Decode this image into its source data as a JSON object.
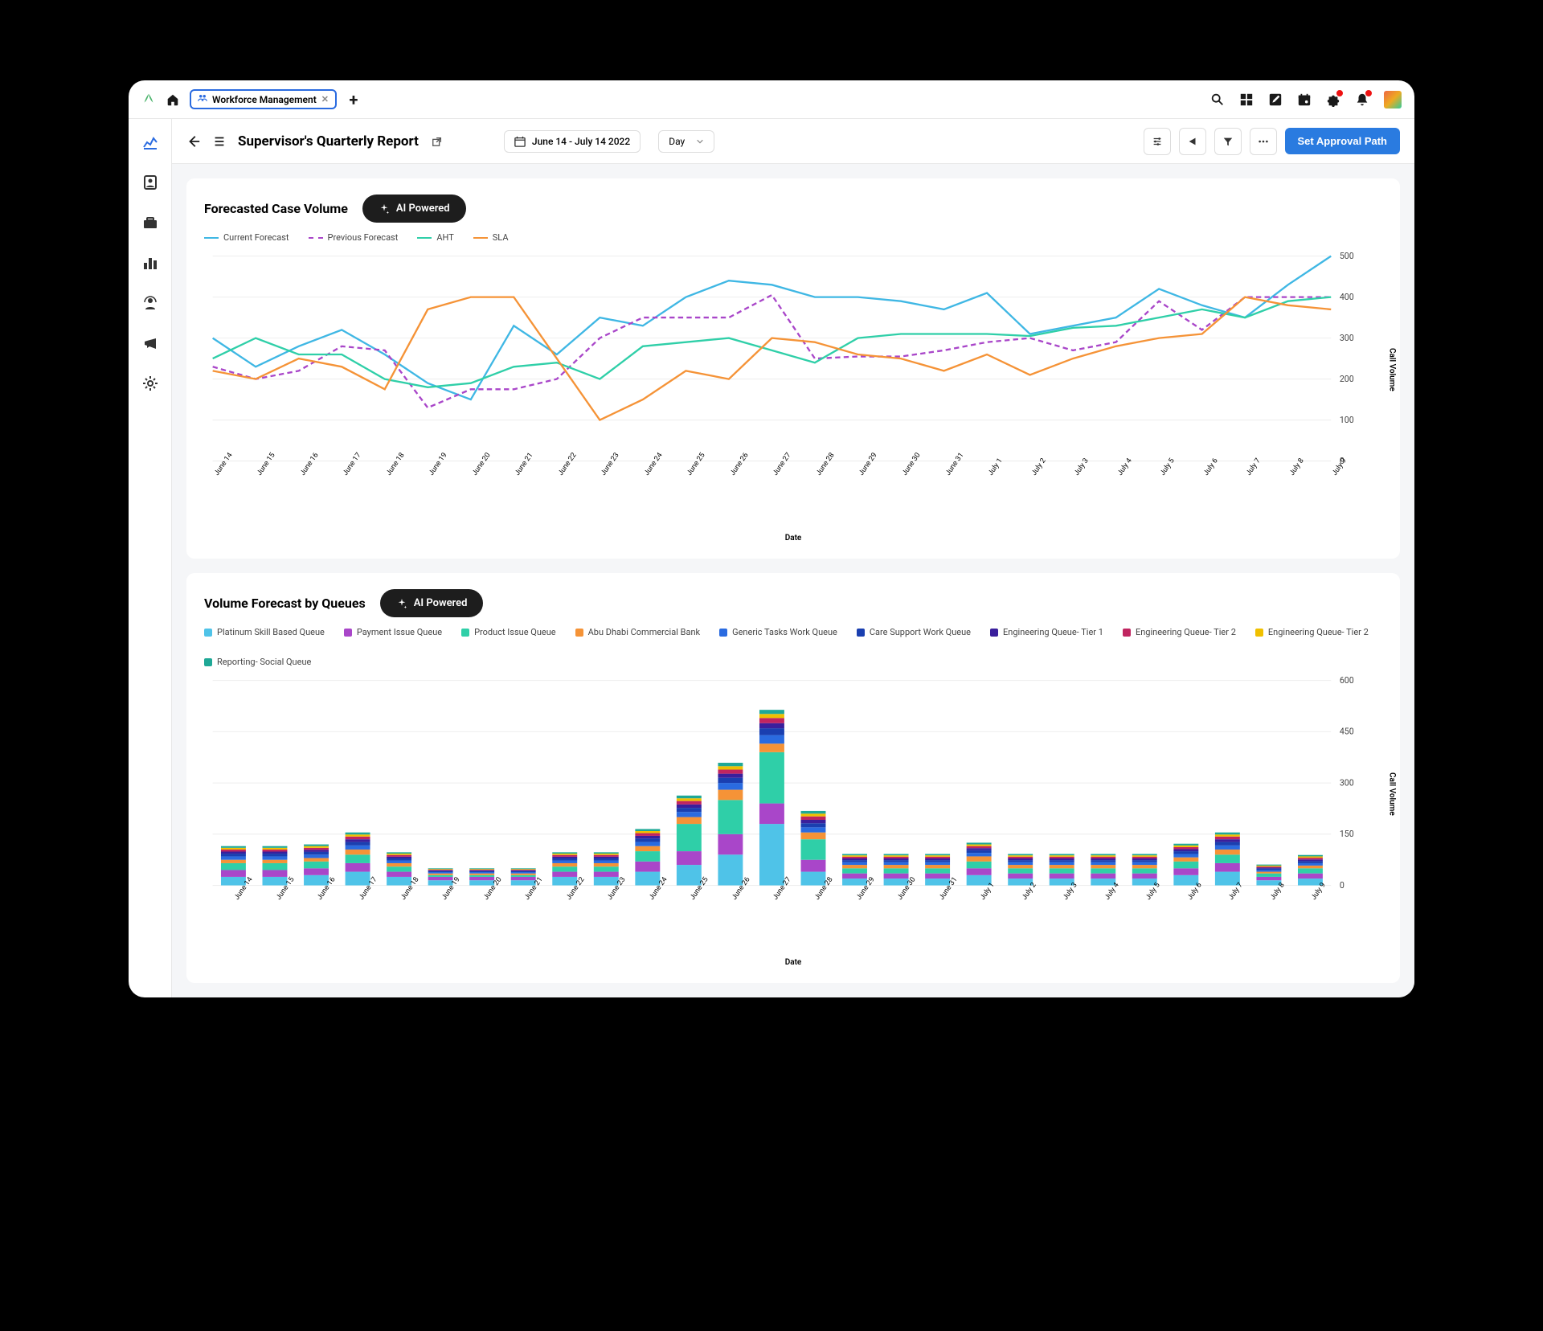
{
  "topbar": {
    "tab_label": "Workforce Management",
    "add_tab": "+"
  },
  "pagehead": {
    "title": "Supervisor's Quarterly Report",
    "date_range": "June 14 - July 14 2022",
    "granularity": "Day",
    "primary_action": "Set Approval Path"
  },
  "chart1": {
    "title": "Forecasted Case Volume",
    "ai_label": "AI Powered",
    "legend": {
      "current": "Current Forecast",
      "previous": "Previous Forecast",
      "aht": "AHT",
      "sla": "SLA"
    },
    "ylabel": "Call Volume",
    "xlabel": "Date"
  },
  "chart2": {
    "title": "Volume Forecast by Queues",
    "ai_label": "AI Powered",
    "legend": [
      "Platinum Skill Based Queue",
      "Payment Issue Queue",
      "Product Issue Queue",
      "Abu Dhabi Commercial Bank",
      "Generic Tasks Work Queue",
      "Care Support Work Queue",
      "Engineering Queue- Tier 1",
      "Engineering Queue- Tier 2",
      "Engineering Queue- Tier 2",
      "Reporting- Social Queue"
    ],
    "ylabel": "Call Volume",
    "xlabel": "Date"
  },
  "chart_data": [
    {
      "type": "line",
      "title": "Forecasted Case Volume",
      "xlabel": "Date",
      "ylabel": "Call Volume",
      "ylim": [
        0,
        500
      ],
      "categories": [
        "June 14",
        "June 15",
        "June 16",
        "June 17",
        "June 18",
        "June 19",
        "June 20",
        "June 21",
        "June 22",
        "June 23",
        "June 24",
        "June 25",
        "June 26",
        "June 27",
        "June 28",
        "June 29",
        "June 30",
        "June 31",
        "July 1",
        "July 2",
        "July 3",
        "July 4",
        "July 5",
        "July 6",
        "July 7",
        "July 8",
        "July 9"
      ],
      "series": [
        {
          "name": "Current Forecast",
          "color": "#3fb7e4",
          "values": [
            300,
            230,
            280,
            320,
            260,
            190,
            150,
            330,
            260,
            350,
            330,
            400,
            440,
            430,
            400,
            400,
            390,
            370,
            410,
            310,
            330,
            350,
            420,
            380,
            350,
            430,
            500
          ]
        },
        {
          "name": "Previous Forecast",
          "color": "#a946c9",
          "dashed": true,
          "values": [
            230,
            200,
            220,
            280,
            270,
            130,
            175,
            175,
            200,
            300,
            350,
            350,
            350,
            405,
            250,
            255,
            255,
            270,
            290,
            300,
            270,
            290,
            390,
            320,
            400,
            400,
            400
          ]
        },
        {
          "name": "AHT",
          "color": "#2fcfa8",
          "values": [
            250,
            300,
            260,
            260,
            200,
            180,
            190,
            230,
            240,
            200,
            280,
            290,
            300,
            270,
            240,
            300,
            310,
            310,
            310,
            305,
            325,
            330,
            350,
            370,
            350,
            390,
            400
          ]
        },
        {
          "name": "SLA",
          "color": "#f59337",
          "values": [
            220,
            200,
            250,
            230,
            175,
            370,
            400,
            400,
            250,
            100,
            150,
            220,
            200,
            300,
            290,
            260,
            250,
            220,
            260,
            210,
            250,
            280,
            300,
            310,
            400,
            380,
            370
          ]
        }
      ]
    },
    {
      "type": "bar",
      "stacked": true,
      "title": "Volume Forecast by Queues",
      "xlabel": "Date",
      "ylabel": "Call Volume",
      "ylim": [
        0,
        600
      ],
      "categories": [
        "June 14",
        "June 15",
        "June 16",
        "June 17",
        "June 18",
        "June 19",
        "June 20",
        "June 21",
        "June 22",
        "June 23",
        "June 24",
        "June 25",
        "June 26",
        "June 27",
        "June 28",
        "June 29",
        "June 30",
        "June 31",
        "July 1",
        "July 2",
        "July 3",
        "July 4",
        "July 5",
        "July 6",
        "July 7",
        "July 8",
        "July 9"
      ],
      "series": [
        {
          "name": "Platinum Skill Based Queue",
          "color": "#4fc3e8",
          "values": [
            25,
            25,
            30,
            40,
            25,
            15,
            15,
            15,
            25,
            25,
            40,
            60,
            90,
            180,
            40,
            20,
            20,
            20,
            30,
            20,
            20,
            20,
            20,
            30,
            40,
            15,
            20
          ]
        },
        {
          "name": "Payment Issue Queue",
          "color": "#a946c9",
          "values": [
            20,
            20,
            20,
            25,
            15,
            10,
            10,
            10,
            15,
            15,
            30,
            40,
            60,
            60,
            35,
            15,
            15,
            15,
            20,
            15,
            15,
            15,
            15,
            20,
            25,
            10,
            15
          ]
        },
        {
          "name": "Product Issue Queue",
          "color": "#2fcfa8",
          "values": [
            20,
            20,
            20,
            25,
            15,
            5,
            5,
            5,
            15,
            15,
            30,
            80,
            100,
            150,
            60,
            15,
            15,
            15,
            20,
            15,
            15,
            15,
            15,
            20,
            25,
            10,
            15
          ]
        },
        {
          "name": "Abu Dhabi Commercial Bank",
          "color": "#f59337",
          "values": [
            10,
            10,
            10,
            15,
            10,
            5,
            5,
            5,
            10,
            10,
            15,
            20,
            30,
            25,
            20,
            10,
            10,
            10,
            15,
            10,
            10,
            10,
            10,
            12,
            15,
            5,
            8
          ]
        },
        {
          "name": "Generic Tasks Work Queue",
          "color": "#2a6be0",
          "values": [
            10,
            10,
            10,
            12,
            8,
            4,
            4,
            4,
            8,
            8,
            12,
            15,
            20,
            25,
            15,
            8,
            8,
            8,
            10,
            8,
            8,
            8,
            8,
            10,
            12,
            5,
            7
          ]
        },
        {
          "name": "Care Support Work Queue",
          "color": "#1a3fb0",
          "values": [
            8,
            8,
            8,
            10,
            6,
            3,
            3,
            3,
            6,
            6,
            10,
            12,
            15,
            20,
            12,
            6,
            6,
            6,
            8,
            6,
            6,
            6,
            6,
            8,
            10,
            4,
            6
          ]
        },
        {
          "name": "Engineering Queue- Tier 1",
          "color": "#3a1f9c",
          "values": [
            6,
            6,
            6,
            8,
            5,
            2,
            2,
            2,
            5,
            5,
            8,
            10,
            12,
            15,
            10,
            5,
            5,
            5,
            6,
            5,
            5,
            5,
            5,
            6,
            8,
            3,
            5
          ]
        },
        {
          "name": "Engineering Queue- Tier 2",
          "color": "#c02560",
          "values": [
            6,
            6,
            6,
            8,
            5,
            2,
            2,
            2,
            5,
            5,
            8,
            10,
            12,
            15,
            10,
            5,
            5,
            5,
            6,
            5,
            5,
            5,
            5,
            6,
            8,
            3,
            5
          ]
        },
        {
          "name": "Engineering Queue- Tier 2",
          "color": "#f0c000",
          "values": [
            5,
            5,
            5,
            6,
            4,
            2,
            2,
            2,
            4,
            4,
            6,
            8,
            10,
            12,
            8,
            4,
            4,
            4,
            5,
            4,
            4,
            4,
            4,
            5,
            6,
            3,
            4
          ]
        },
        {
          "name": "Reporting- Social Queue",
          "color": "#1fa896",
          "values": [
            5,
            5,
            5,
            6,
            4,
            2,
            2,
            2,
            4,
            4,
            6,
            8,
            10,
            12,
            8,
            4,
            4,
            4,
            5,
            4,
            4,
            4,
            4,
            5,
            6,
            3,
            4
          ]
        }
      ]
    }
  ]
}
